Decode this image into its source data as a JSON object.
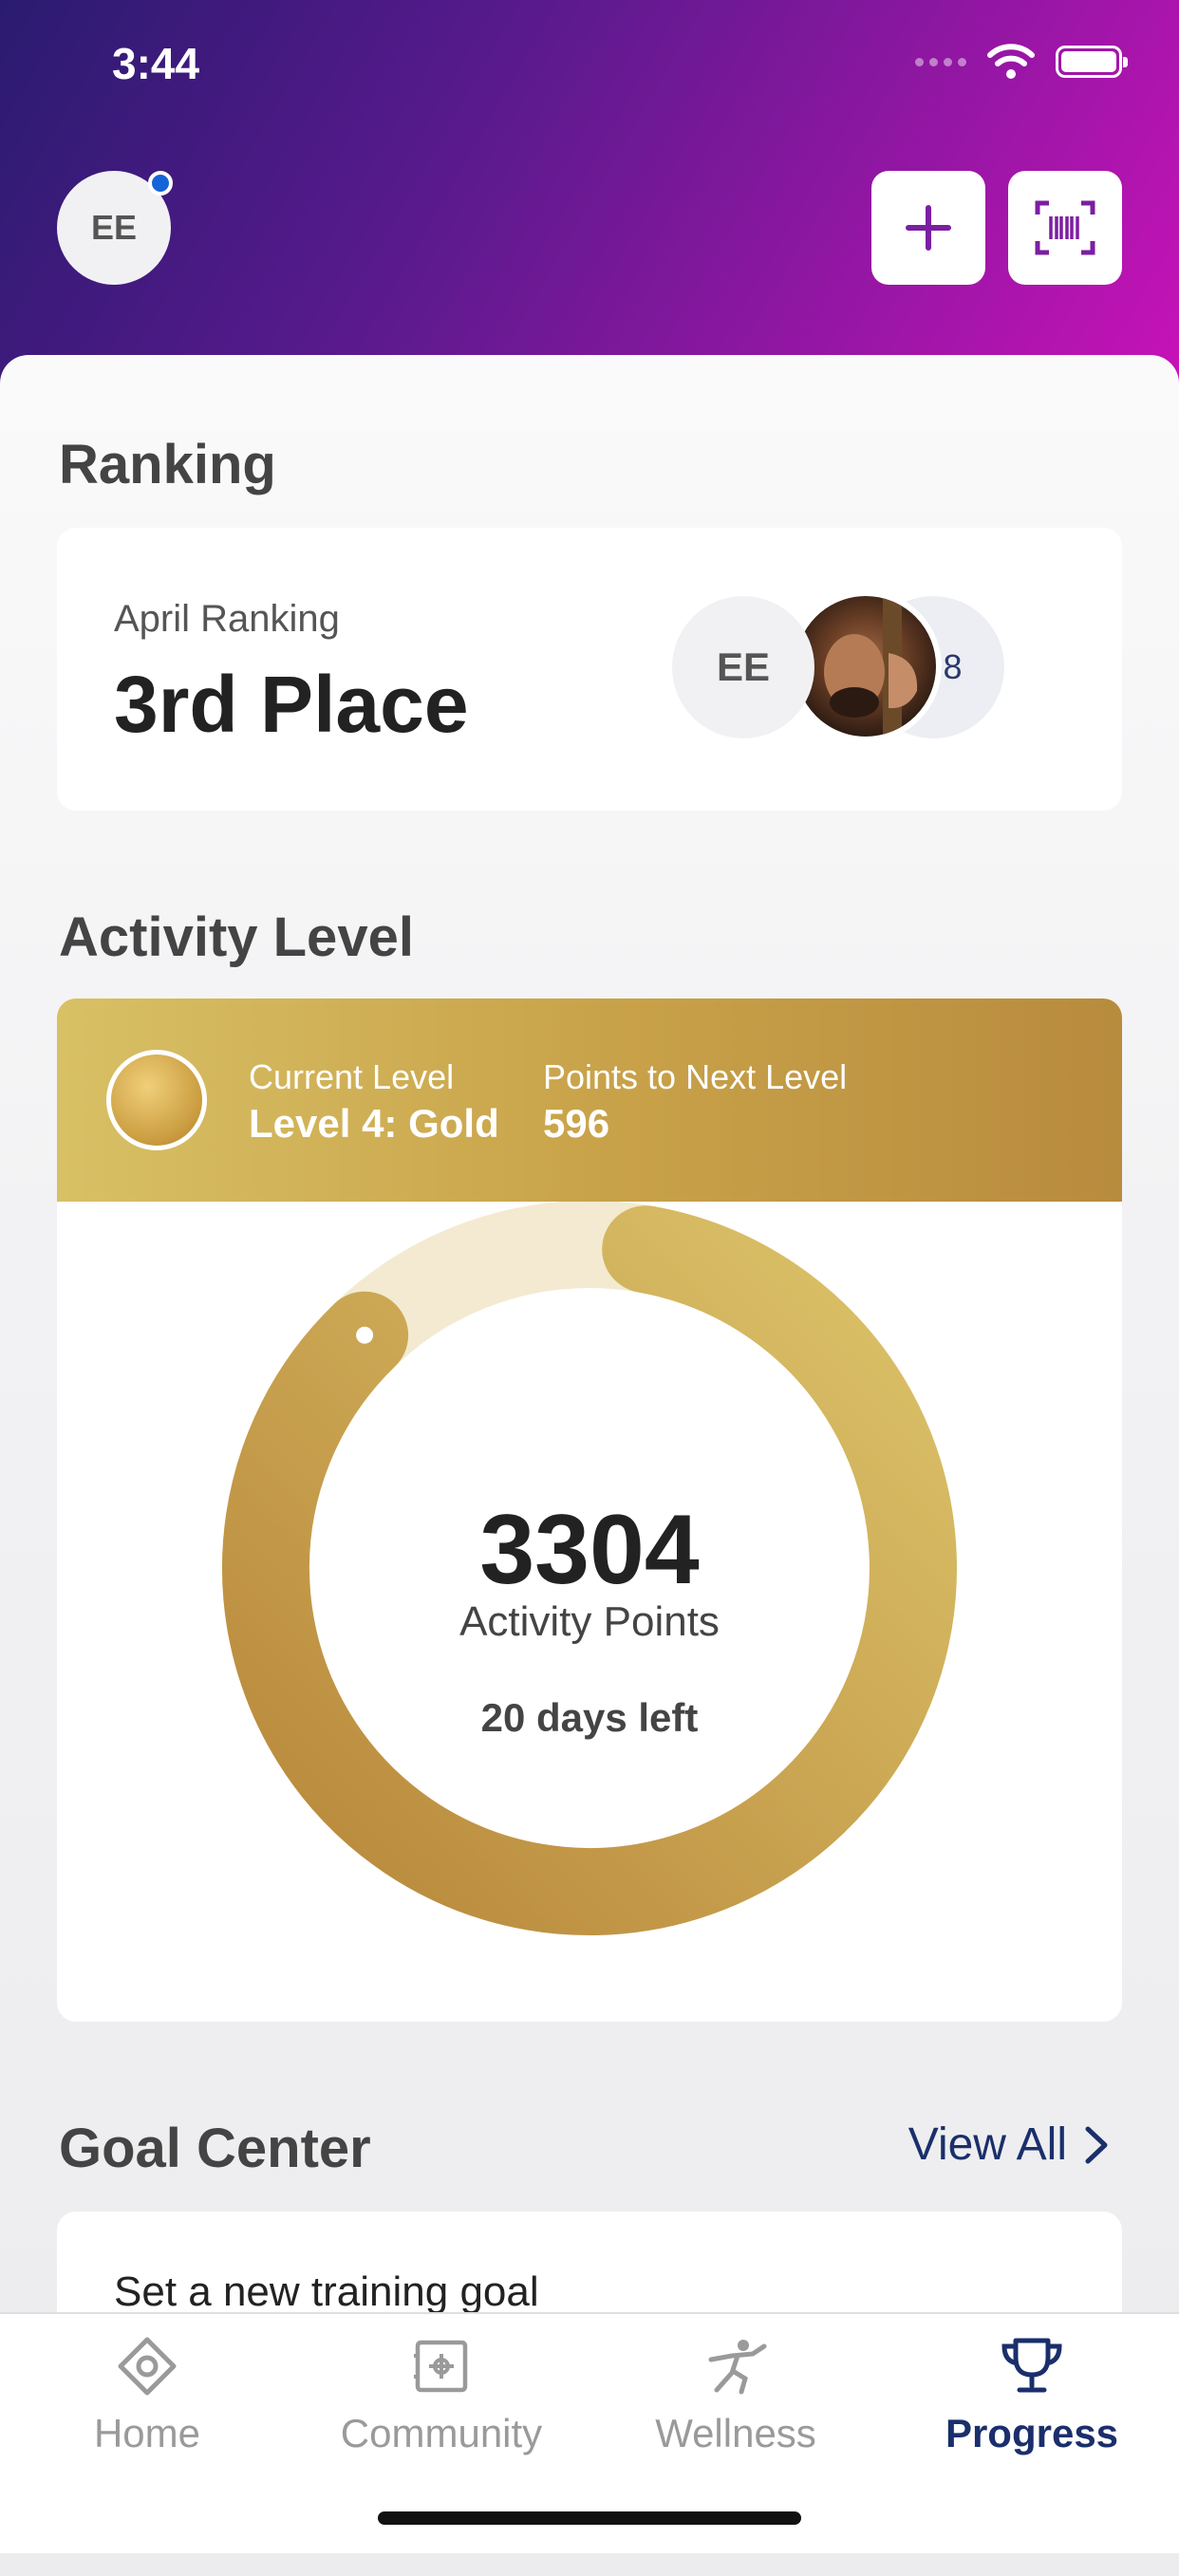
{
  "status_bar": {
    "time": "3:44",
    "icons": [
      "signal-icon",
      "wifi-icon",
      "battery-icon"
    ]
  },
  "header": {
    "avatar_initials": "EE",
    "buttons": [
      {
        "icon": "plus-icon"
      },
      {
        "icon": "barcode-scan-icon"
      }
    ],
    "colors": {
      "gradient_start": "#2a1b70",
      "gradient_end": "#c812b8",
      "notification_dot": "#1565d8",
      "accent": "#7b1fa2"
    }
  },
  "ranking": {
    "section_title": "Ranking",
    "period_label": "April Ranking",
    "place": "3rd Place",
    "avatars": [
      {
        "initials": "EE"
      },
      {
        "type": "photo"
      },
      {
        "more": "+8"
      }
    ]
  },
  "activity": {
    "section_title": "Activity Level",
    "current_level_label": "Current Level",
    "current_level_value": "Level 4: Gold",
    "next_level_label": "Points to Next Level",
    "next_level_value": "596",
    "points": "3304",
    "points_label": "Activity Points",
    "days_left": "20 days left",
    "progress_fraction": 0.85,
    "colors": {
      "gold_light": "#dcc36a",
      "gold_dark": "#b8873a",
      "track": "#f3ead1"
    }
  },
  "goals": {
    "section_title": "Goal Center",
    "view_all": "View All",
    "first_item": "Set a new training goal"
  },
  "tabs": [
    {
      "label": "Home",
      "icon": "home-icon",
      "active": false
    },
    {
      "label": "Community",
      "icon": "community-icon",
      "active": false
    },
    {
      "label": "Wellness",
      "icon": "wellness-icon",
      "active": false
    },
    {
      "label": "Progress",
      "icon": "trophy-icon",
      "active": true
    }
  ]
}
